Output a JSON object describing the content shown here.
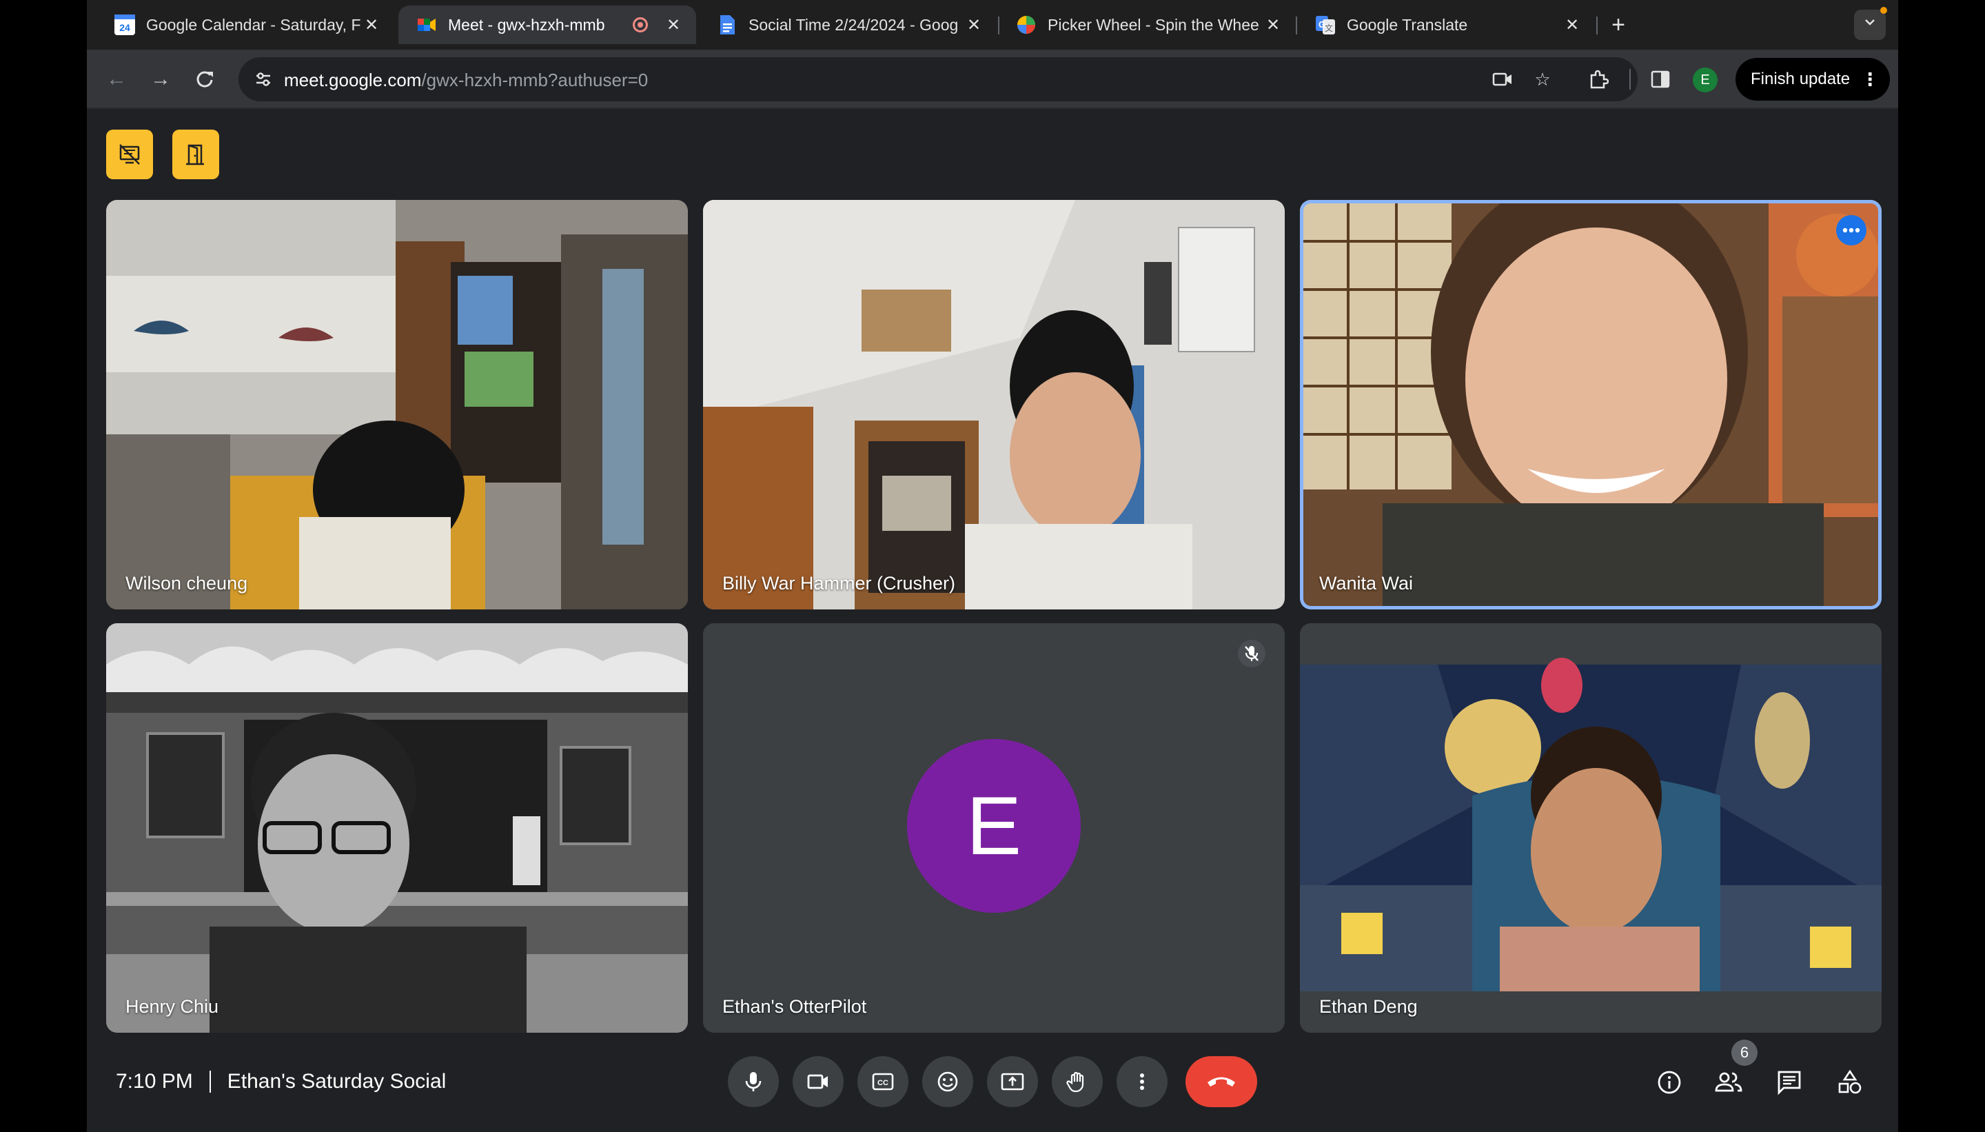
{
  "browser": {
    "tabs": [
      {
        "title": "Google Calendar - Saturday, F",
        "favicon": "calendar-favicon",
        "active": false
      },
      {
        "title": "Meet - gwx-hzxh-mmb",
        "favicon": "meet-favicon",
        "active": true,
        "recording": true
      },
      {
        "title": "Social Time 2/24/2024 - Goog",
        "favicon": "docs-favicon",
        "active": false
      },
      {
        "title": "Picker Wheel - Spin the Whee",
        "favicon": "wheel-favicon",
        "active": false
      },
      {
        "title": "Google Translate",
        "favicon": "translate-favicon",
        "active": false
      }
    ],
    "calendar_day": "24",
    "url_host": "meet.google.com",
    "url_path": "/gwx-hzxh-mmb?authuser=0",
    "profile_initial": "E",
    "finish_update_label": "Finish update"
  },
  "meet": {
    "participants": [
      {
        "name": "Wilson cheung",
        "type": "video"
      },
      {
        "name": "Billy War Hammer (Crusher)",
        "type": "video"
      },
      {
        "name": "Wanita Wai",
        "type": "video",
        "speaking": true
      },
      {
        "name": "Henry Chiu",
        "type": "video"
      },
      {
        "name": "Ethan's OtterPilot",
        "type": "avatar",
        "initial": "E",
        "muted": true,
        "avatar_color": "#7b1fa2"
      },
      {
        "name": "Ethan Deng",
        "type": "video"
      }
    ],
    "time": "7:10 PM",
    "meeting_title": "Ethan's Saturday Social",
    "people_count": "6"
  },
  "colors": {
    "accent": "#8ab4f8",
    "hangup": "#ea4335",
    "host_controls": "#fbc02d"
  }
}
